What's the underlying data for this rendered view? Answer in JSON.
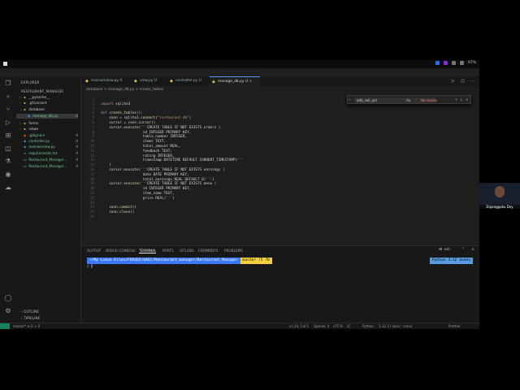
{
  "os_tray": {
    "battery": "97%"
  },
  "sidebar": {
    "title": "EXPLORER",
    "project": "RESTAURANT_MANAGER",
    "items": [
      {
        "label": "__pycache__",
        "status": ""
      },
      {
        "label": ".gfconnect",
        "status": ""
      },
      {
        "label": "database",
        "status": ""
      },
      {
        "label": "manage_db.py",
        "status": "U"
      },
      {
        "label": "forms",
        "status": ""
      },
      {
        "label": "views",
        "status": ""
      },
      {
        "label": ".gitignore",
        "status": "A"
      },
      {
        "label": "controller.py",
        "status": "A"
      },
      {
        "label": "mainwindow.py",
        "status": "A"
      },
      {
        "label": "requirements.txt",
        "status": "A"
      },
      {
        "label": "Restaurant_Manager...",
        "status": "A"
      },
      {
        "label": "Restaurant_Manager...",
        "status": "A"
      }
    ],
    "outline": "OUTLINE",
    "timeline": "TIMELINE"
  },
  "tabs": [
    {
      "label": "mainwindow.py  A",
      "active": false
    },
    {
      "label": "view.py  U",
      "active": false
    },
    {
      "label": "controller.py  U",
      "active": false
    },
    {
      "label": "manage_db.py  U",
      "active": true
    }
  ],
  "breadcrumb": "database  >  manage_db.py  >  create_tables",
  "find": {
    "query": "$db_sell_qnt",
    "case": "Aa",
    "result": "No results"
  },
  "code_lines": [
    "",
    "import sqlite3",
    "",
    "def create_tables():",
    "    conn = sqlite3.connect(\"restaurant.db\")",
    "    cursor = conn.cursor()",
    "    cursor.execute('''CREATE TABLE IF NOT EXISTS orders (",
    "                    id INTEGER PRIMARY KEY,",
    "                    table_number INTEGER,",
    "                    items TEXT,",
    "                    total_amount REAL,",
    "                    feedback TEXT,",
    "                    rating INTEGER,",
    "                    timestamp DATETIME DEFAULT CURRENT_TIMESTAMP)'''",
    "    )",
    "    cursor.execute('''CREATE TABLE IF NOT EXISTS earnings (",
    "                    date DATE PRIMARY KEY,",
    "                    total_earnings REAL DEFAULT 0)''')",
    "    cursor.execute('''CREATE TABLE IF NOT EXISTS menu (",
    "                    id INTEGER PRIMARY KEY,",
    "                    item_name TEXT,",
    "                    price REAL)''')",
    "",
    "    conn.commit()",
    "    conn.close()",
    ""
  ],
  "panel": {
    "tabs": [
      "OUTPUT",
      "DEBUG CONSOLE",
      "TERMINAL",
      "PORTS",
      "GITLENS",
      "COMMENTS",
      "PROBLEMS"
    ],
    "active_tab": "TERMINAL",
    "shell": "zsh",
    "prompt_path": "~/My Linux Files/FOSSEE/OAEC/Restaurant_manager/Restaurant_Manager",
    "prompt_git": "master !5 ?6",
    "venv": "Python 3.12 3venv"
  },
  "statusbar": {
    "left": "master*  ⊗ 0 ⚠ 0",
    "position": "Ln 24, Col 5",
    "spaces": "Spaces: 4",
    "encoding": "UTF-8",
    "eol": "LF",
    "language": "Python",
    "interpreter": "3.12.3 ('venv': venv)",
    "prettier": "Prettier"
  },
  "webcam": {
    "name": "Dipanggoku Dey"
  }
}
